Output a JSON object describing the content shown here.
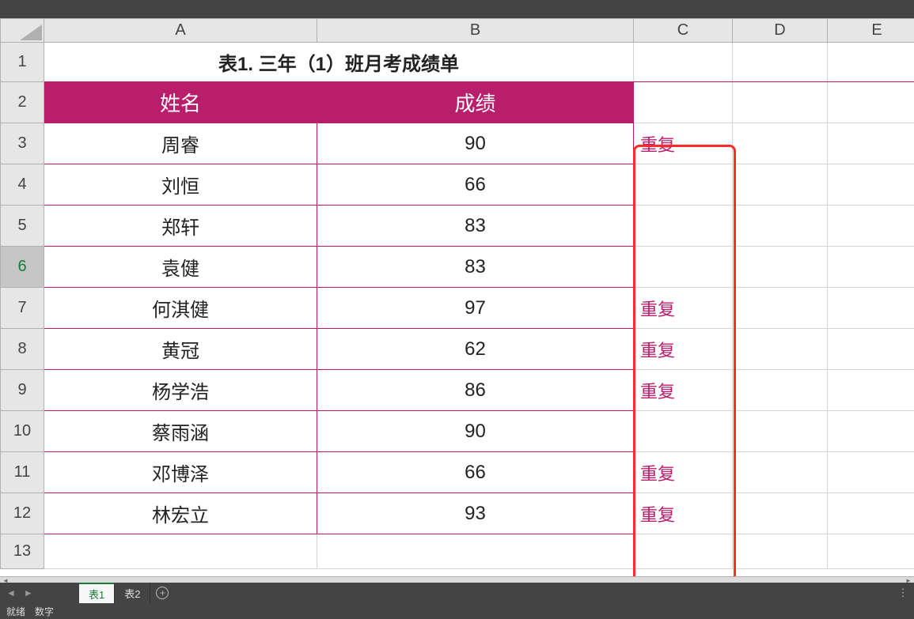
{
  "columns": [
    "A",
    "B",
    "C",
    "D",
    "E"
  ],
  "rowNumbers": [
    "1",
    "2",
    "3",
    "4",
    "5",
    "6",
    "7",
    "8",
    "9",
    "10",
    "11",
    "12",
    "13"
  ],
  "activeRow": 6,
  "title": "表1. 三年（1）班月考成绩单",
  "header": {
    "name": "姓名",
    "score": "成绩"
  },
  "rows": [
    {
      "name": "周睿",
      "score": "90",
      "c": "重复"
    },
    {
      "name": "刘恒",
      "score": "66",
      "c": ""
    },
    {
      "name": "郑轩",
      "score": "83",
      "c": ""
    },
    {
      "name": "袁健",
      "score": "83",
      "c": ""
    },
    {
      "name": "何淇健",
      "score": "97",
      "c": "重复"
    },
    {
      "name": "黄冠",
      "score": "62",
      "c": "重复"
    },
    {
      "name": "杨学浩",
      "score": "86",
      "c": "重复"
    },
    {
      "name": "蔡雨涵",
      "score": "90",
      "c": ""
    },
    {
      "name": "邓博泽",
      "score": "66",
      "c": "重复"
    },
    {
      "name": "林宏立",
      "score": "93",
      "c": "重复"
    }
  ],
  "tabs": {
    "t1": "表1",
    "t2": "表2"
  },
  "status": {
    "ready": "就绪",
    "mode": "数字"
  },
  "icons": {
    "add": "+",
    "dots": "⋮",
    "left": "◄",
    "right": "►",
    "leftStop": "|◄",
    "rightStop": "►|"
  }
}
